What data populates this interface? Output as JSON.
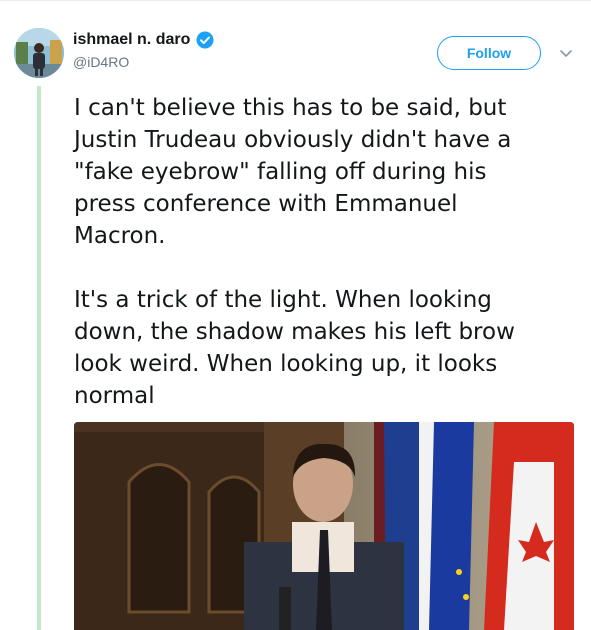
{
  "tweet": {
    "author": {
      "display_name": "ishmael n. daro",
      "handle": "@iD4RO",
      "verified": true
    },
    "follow_label": "Follow",
    "paragraphs": [
      "I can't believe this has to be said, but\nJustin Trudeau obviously didn't have a\n\"fake eyebrow\" falling off during his\npress conference with Emmanuel\nMacron.",
      "It's a trick of the light. When looking\ndown, the shadow makes his left brow\nlook weird. When looking up, it looks\nnormal"
    ]
  },
  "icons": {
    "verified": "verified-badge-icon",
    "caret": "chevron-down-icon"
  },
  "colors": {
    "accent": "#1da1f2",
    "thread_line": "#c8e6c9",
    "text": "#14171a",
    "muted": "#657786"
  }
}
